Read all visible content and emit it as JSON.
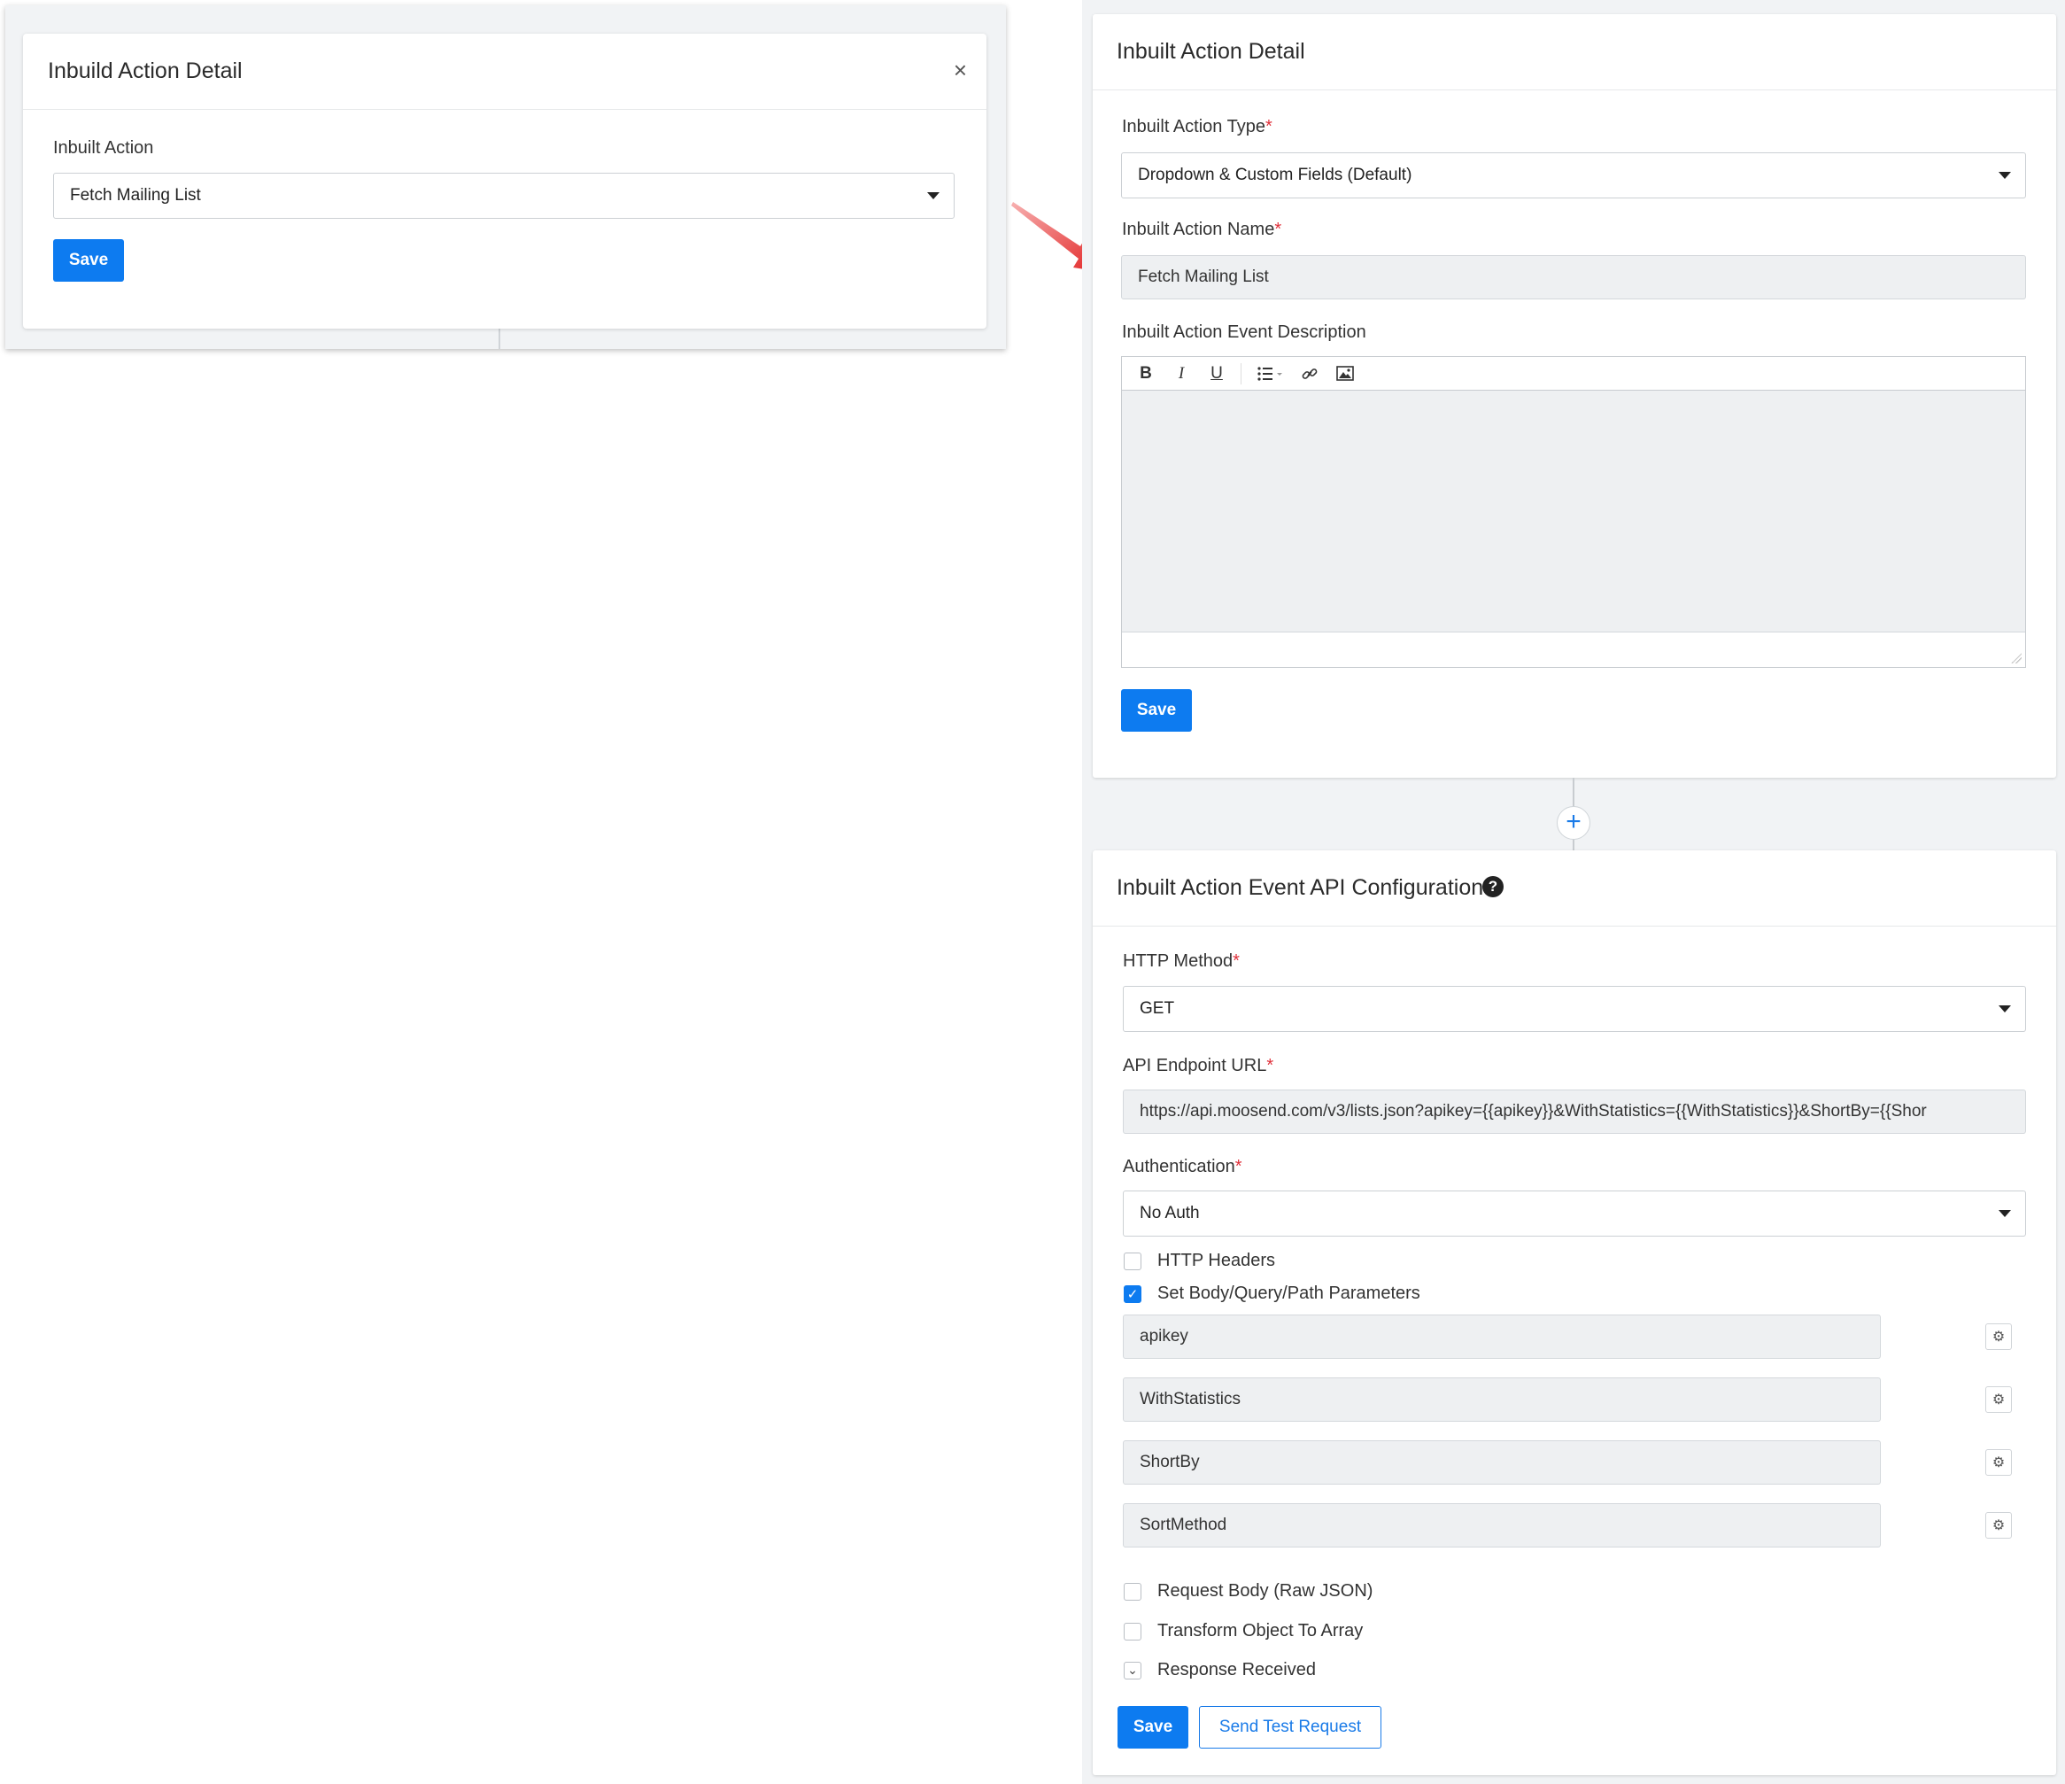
{
  "left_modal": {
    "title": "Inbuild Action Detail",
    "close_icon": "×",
    "field_label": "Inbuilt Action",
    "field_value": "Fetch Mailing List",
    "save_label": "Save"
  },
  "action_detail": {
    "title": "Inbuilt Action Detail",
    "type_label": "Inbuilt Action Type",
    "type_value": "Dropdown & Custom Fields (Default)",
    "name_label": "Inbuilt Action Name",
    "name_value": "Fetch Mailing List",
    "desc_label": "Inbuilt Action Event Description",
    "toolbar": {
      "bold": "B",
      "italic": "I",
      "underline": "U"
    },
    "save_label": "Save",
    "required_mark": "*"
  },
  "connector": {
    "plus": "+"
  },
  "api_config": {
    "title": "Inbuilt Action Event API Configuration",
    "help_icon": "?",
    "method_label": "HTTP Method",
    "method_value": "GET",
    "endpoint_label": "API Endpoint URL",
    "endpoint_value": "https://api.moosend.com/v3/lists.json?apikey={{apikey}}&WithStatistics={{WithStatistics}}&ShortBy={{Shor",
    "auth_label": "Authentication",
    "auth_value": "No Auth",
    "headers_label": "HTTP Headers",
    "params_label": "Set Body/Query/Path Parameters",
    "params": [
      {
        "name": "apikey"
      },
      {
        "name": "WithStatistics"
      },
      {
        "name": "ShortBy"
      },
      {
        "name": "SortMethod"
      }
    ],
    "raw_json_label": "Request Body (Raw JSON)",
    "transform_label": "Transform Object To Array",
    "response_label": "Response Received",
    "save_label": "Save",
    "test_label": "Send Test Request",
    "required_mark": "*"
  },
  "colors": {
    "primary": "#0d7bf0",
    "required": "#e0303a",
    "arrow": "#e8202a",
    "panel_bg": "#f1f3f5"
  }
}
